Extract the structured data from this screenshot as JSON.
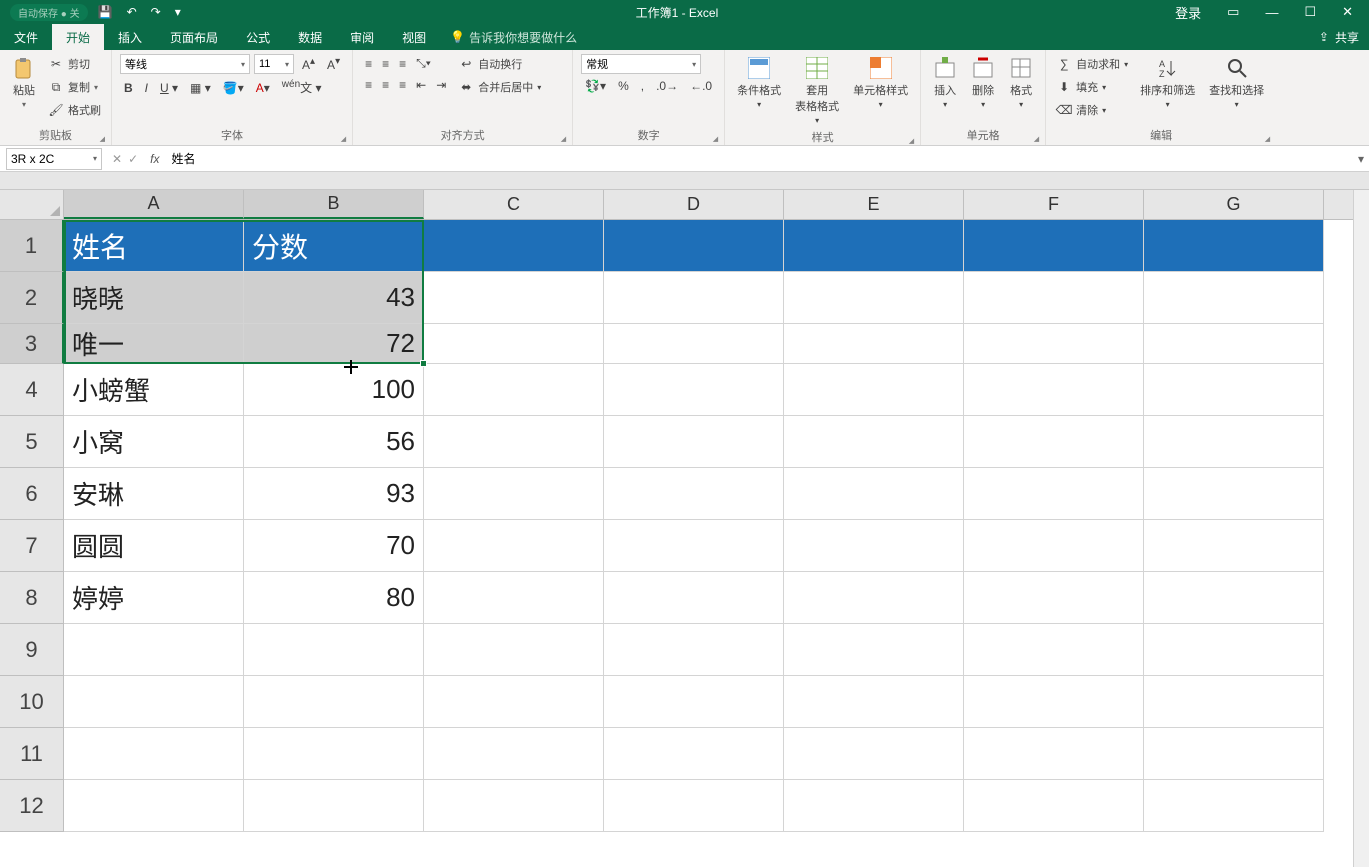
{
  "title_bar": {
    "autosave": "自动保存 ● 关",
    "doc_title": "工作簿1 - Excel",
    "login": "登录"
  },
  "ribbon_tabs": {
    "file": "文件",
    "home": "开始",
    "insert": "插入",
    "layout": "页面布局",
    "formulas": "公式",
    "data": "数据",
    "review": "审阅",
    "view": "视图",
    "tell_me": "告诉我你想要做什么",
    "share": "共享"
  },
  "ribbon": {
    "clipboard": {
      "paste": "粘贴",
      "cut": "剪切",
      "copy": "复制",
      "format_painter": "格式刷",
      "label": "剪贴板"
    },
    "font": {
      "font_name": "等线",
      "font_size": "11",
      "label": "字体"
    },
    "alignment": {
      "wrap": "自动换行",
      "merge": "合并后居中",
      "label": "对齐方式"
    },
    "number": {
      "format": "常规",
      "label": "数字"
    },
    "styles": {
      "conditional": "条件格式",
      "table": "套用\n表格格式",
      "cell": "单元格样式",
      "label": "样式"
    },
    "cells": {
      "insert": "插入",
      "delete": "删除",
      "format": "格式",
      "label": "单元格"
    },
    "editing": {
      "autosum": "自动求和",
      "fill": "填充",
      "clear": "清除",
      "sort": "排序和筛选",
      "find": "查找和选择",
      "label": "编辑"
    }
  },
  "formula_bar": {
    "name_box": "3R x 2C",
    "formula": "姓名"
  },
  "grid": {
    "col_headers": [
      "A",
      "B",
      "C",
      "D",
      "E",
      "F",
      "G"
    ],
    "row_headers": [
      "1",
      "2",
      "3",
      "4",
      "5",
      "6",
      "7",
      "8",
      "9",
      "10",
      "11",
      "12"
    ],
    "header": {
      "name": "姓名",
      "score": "分数"
    },
    "rows": [
      {
        "name": "晓晓",
        "score": "43"
      },
      {
        "name": "唯一",
        "score": "72"
      },
      {
        "name": "小螃蟹",
        "score": "100"
      },
      {
        "name": "小窝",
        "score": "56"
      },
      {
        "name": "安琳",
        "score": "93"
      },
      {
        "name": "圆圆",
        "score": "70"
      },
      {
        "name": "婷婷",
        "score": "80"
      }
    ]
  }
}
